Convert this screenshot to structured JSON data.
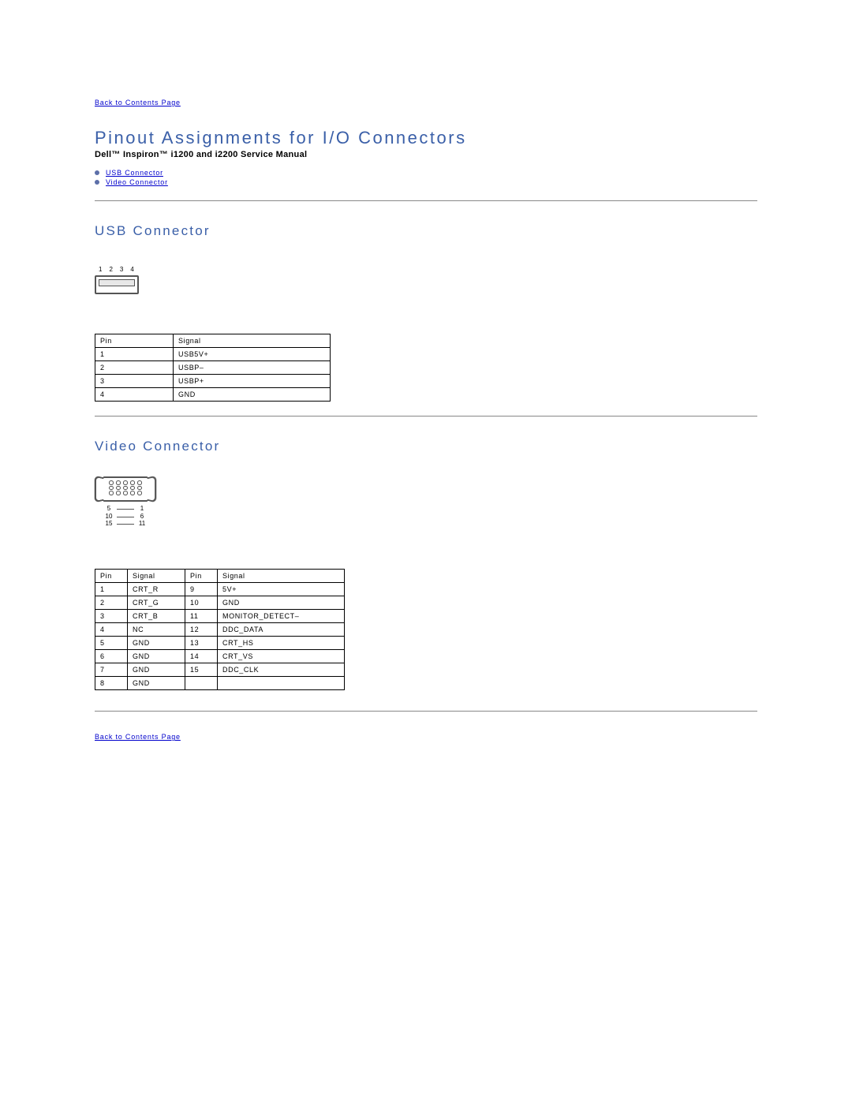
{
  "links": {
    "back_top": "Back to Contents Page",
    "usb": "USB Connector",
    "video": "Video Connector",
    "back_bottom": "Back to Contents Page"
  },
  "title": "Pinout Assignments for I/O Connectors",
  "subtitle": "Dell™ Inspiron™ i1200 and i2200 Service Manual",
  "sections": {
    "usb": {
      "heading": "USB Connector",
      "pin_numbers": [
        "1",
        "2",
        "3",
        "4"
      ],
      "table": {
        "headers": [
          "Pin",
          "Signal"
        ],
        "rows": [
          [
            "1",
            "USB5V+"
          ],
          [
            "2",
            "USBP–"
          ],
          [
            "3",
            "USBP+"
          ],
          [
            "4",
            "GND"
          ]
        ]
      }
    },
    "video": {
      "heading": "Video Connector",
      "label_rows": [
        [
          "5",
          "1"
        ],
        [
          "10",
          "6"
        ],
        [
          "15",
          "11"
        ]
      ],
      "table": {
        "headers": [
          "Pin",
          "Signal",
          "Pin",
          "Signal"
        ],
        "rows": [
          [
            "1",
            "CRT_R",
            "9",
            "5V+"
          ],
          [
            "2",
            "CRT_G",
            "10",
            "GND"
          ],
          [
            "3",
            "CRT_B",
            "11",
            "MONITOR_DETECT–"
          ],
          [
            "4",
            "NC",
            "12",
            "DDC_DATA"
          ],
          [
            "5",
            "GND",
            "13",
            "CRT_HS"
          ],
          [
            "6",
            "GND",
            "14",
            "CRT_VS"
          ],
          [
            "7",
            "GND",
            "15",
            "DDC_CLK"
          ],
          [
            "8",
            "GND",
            "",
            ""
          ]
        ]
      }
    }
  }
}
